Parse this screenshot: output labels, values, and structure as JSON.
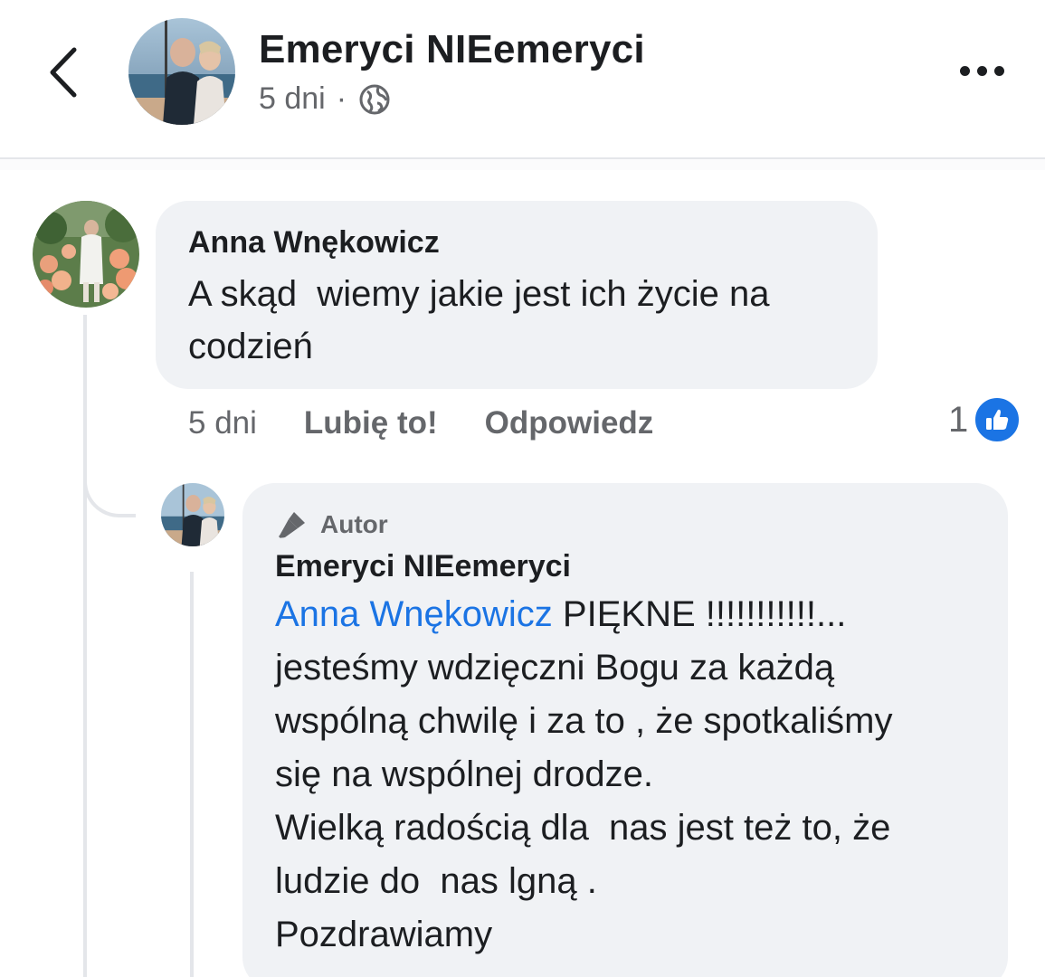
{
  "header": {
    "title": "Emeryci NIEemeryci",
    "time": "5 dni",
    "separator": "·",
    "audience_icon": "globe-icon",
    "back_icon": "chevron-left-icon",
    "more_icon": "more-horizontal-icon"
  },
  "comment": {
    "author": "Anna Wnękowicz",
    "text_lines": [
      "A skąd  wiemy jakie jest ich życie na",
      "codzień"
    ],
    "time": "5 dni",
    "like_label": "Lubię to!",
    "reply_label": "Odpowiedz",
    "reaction_count": "1",
    "reaction_icon": "thumbs-up-icon"
  },
  "reply": {
    "badge_label": "Autor",
    "badge_icon": "microphone-icon",
    "author": "Emeryci NIEemeryci",
    "mention": "Anna Wnękowicz",
    "first_line_rest": " PIĘKNE !!!!!!!!!!!...",
    "lines": [
      "jesteśmy wdzięczni Bogu za każdą",
      "wspólną chwilę i za to , że spotkaliśmy",
      "się na wspólnej drodze.",
      "Wielką radością dla  nas jest też to, że",
      "ludzie do  nas lgną .",
      "Pozdrawiamy"
    ]
  },
  "colors": {
    "accent": "#1b74e4",
    "bubble": "#f0f2f5",
    "secondary_text": "#65676b",
    "primary_text": "#1c1e21"
  }
}
